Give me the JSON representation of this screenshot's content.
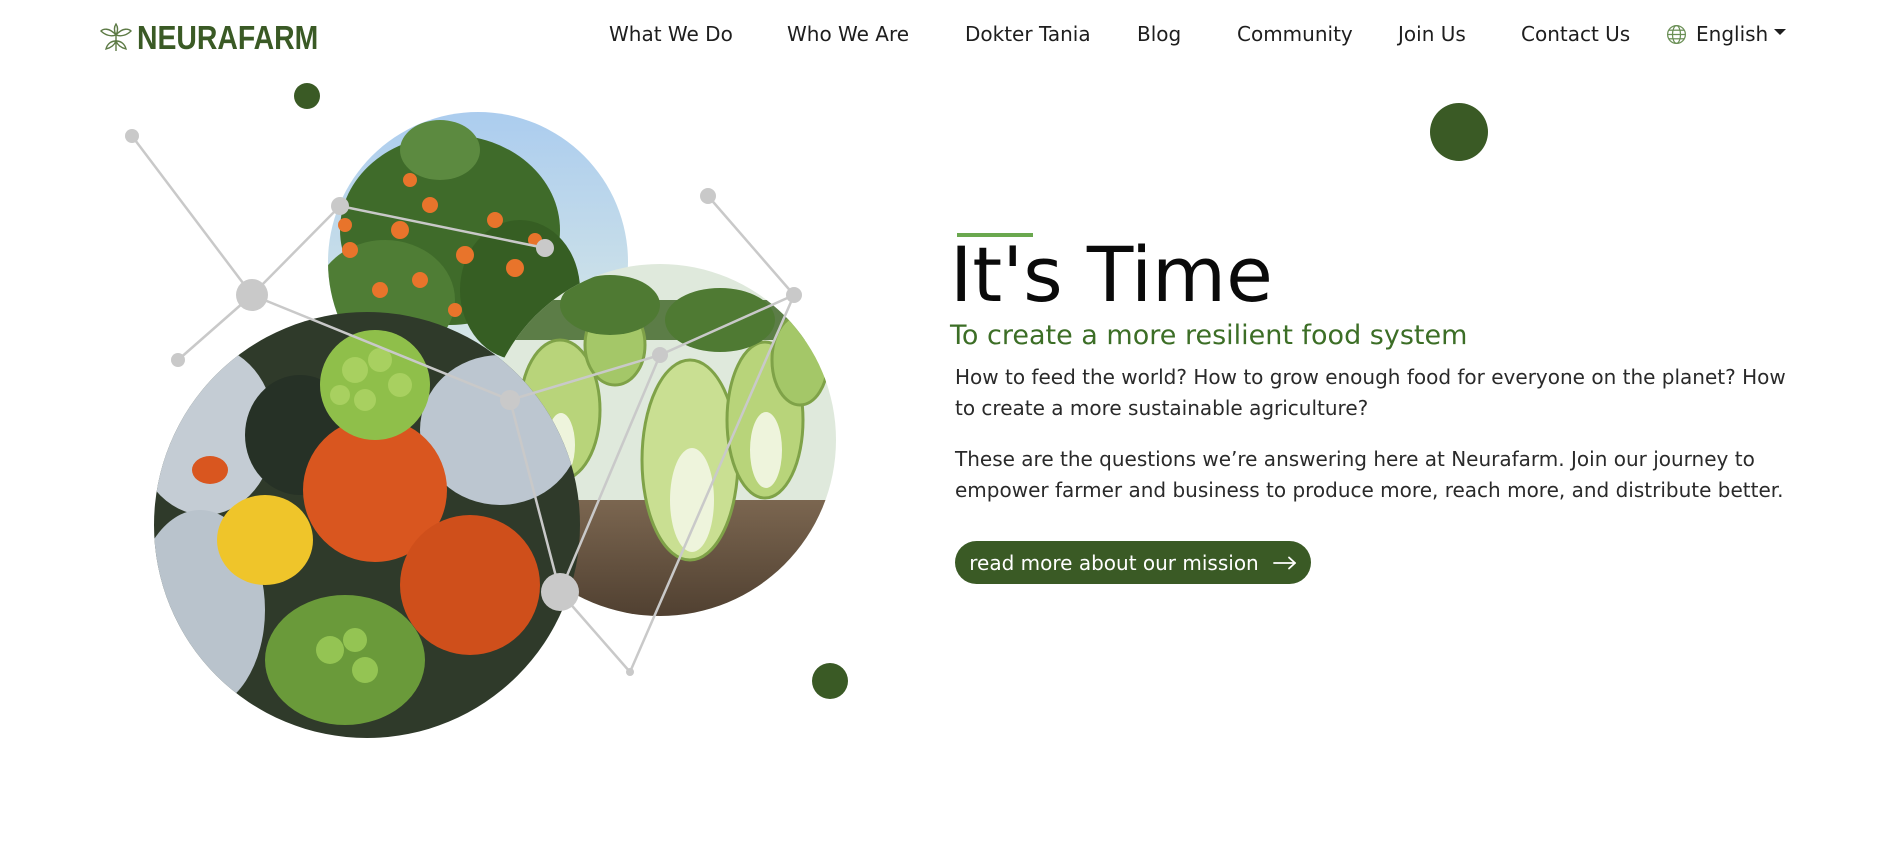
{
  "header": {
    "logo_text": "NEURAFARM",
    "nav": [
      {
        "label": "What We Do"
      },
      {
        "label": "Who We Are"
      },
      {
        "label": "Dokter Tania"
      },
      {
        "label": "Blog"
      },
      {
        "label": "Community"
      },
      {
        "label": "Join Us"
      },
      {
        "label": "Contact Us"
      }
    ],
    "language": {
      "label": "English",
      "icon": "globe-icon"
    }
  },
  "hero": {
    "title": "It's Time",
    "subtitle": "To create a more resilient food system",
    "paragraphs": [
      "How to feed the world? How to grow enough food for everyone on the planet? How to create a more sustainable agriculture?",
      "These are the questions we’re answering here at Neurafarm. Join our journey to empower farmer and business to produce more, reach more, and distribute better."
    ],
    "cta": {
      "label": "read more about our mission",
      "icon": "arrow-right-icon"
    },
    "images": [
      {
        "name": "tangerine-tree-photo"
      },
      {
        "name": "chinese-cabbage-field-photo"
      },
      {
        "name": "squash-and-vegetables-photo"
      }
    ]
  },
  "colors": {
    "brand_green": "#3a5a25",
    "accent_green": "#6aa84f",
    "subtitle_green": "#3c6e26",
    "network_gray": "#c9c9c9"
  }
}
